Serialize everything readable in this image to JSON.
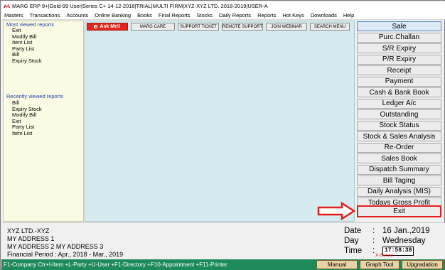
{
  "window": {
    "title": "MARG ERP 9+|Gold-99 User|Series C+ 14-12-2018|TRIAL|MULTI FIRM|XYZ-XYZ LTD. 2018-2019|USER-A"
  },
  "menu": {
    "items": [
      "Masters",
      "Transactions",
      "Accounts",
      "Online Banking",
      "Books",
      "Final Reports",
      "Stocks",
      "Daily Reports",
      "Reports",
      "Hot Keys",
      "Downloads",
      "Help"
    ]
  },
  "left_panel": {
    "most_viewed_title": "Most viewed reports",
    "most_viewed": [
      "Exit",
      "Modify Bill",
      "Item List",
      "Party List",
      "Bill",
      "Expiry Stock"
    ],
    "recent_title": "Recently viewed reports",
    "recent": [
      "Bill",
      "Expiry Stock",
      "Modify Bill",
      "Exit",
      "Party List",
      "Item List"
    ]
  },
  "toolbar": {
    "ask_me": "Ask Me!!",
    "marg_care": "MARG CARE",
    "support_ticket": "SUPPORT TICKET",
    "remote_support": "REMOTE SUPPORT",
    "join_webinar": "JOIN WEBINAR",
    "search_menu": "SEARCH MENU"
  },
  "shortcuts": [
    "Sale",
    "Purc.Challan",
    "S/R Expiry",
    "P/R Expiry",
    "Receipt",
    "Payment",
    "Cash & Bank Book",
    "Ledger A/c",
    "Outstanding",
    "Stock Status",
    "Stock & Sales Analysis",
    "Re-Order",
    "Sales Book",
    "Dispatch Summary",
    "Bill Taging",
    "Daily Analysis (MIS)",
    "Todays Gross Profit",
    "Exit"
  ],
  "company": {
    "name": "XYZ LTD.-XYZ",
    "address1": "MY ADDRESS 1",
    "address2": "MY ADDRESS 2 MY ADDRESS 3",
    "financial_period": "Financial Period : Apr., 2018 - Mar., 2019"
  },
  "datetime": {
    "date_label": "Date",
    "date_value": "16 Jan.,2019",
    "day_label": "Day",
    "day_value": "Wednesday",
    "time_label": "Time",
    "time_value": "17:58:38",
    "server": "X-Server"
  },
  "statusbar": {
    "text": "F1-Company Ctr+I-Item +L-Party +U-User +F1-Directory +F10-Appointment +F11-Printer",
    "manual": "Manual",
    "graph_tool": "Graph Tool",
    "upgradation": "Upgradation"
  },
  "colors": {
    "status_green": "#1d8a5a",
    "center_bg": "#d5ebf0",
    "left_bg": "#fbfbe3",
    "accent_red": "#e0201c",
    "link_blue": "#1f3fa8"
  }
}
